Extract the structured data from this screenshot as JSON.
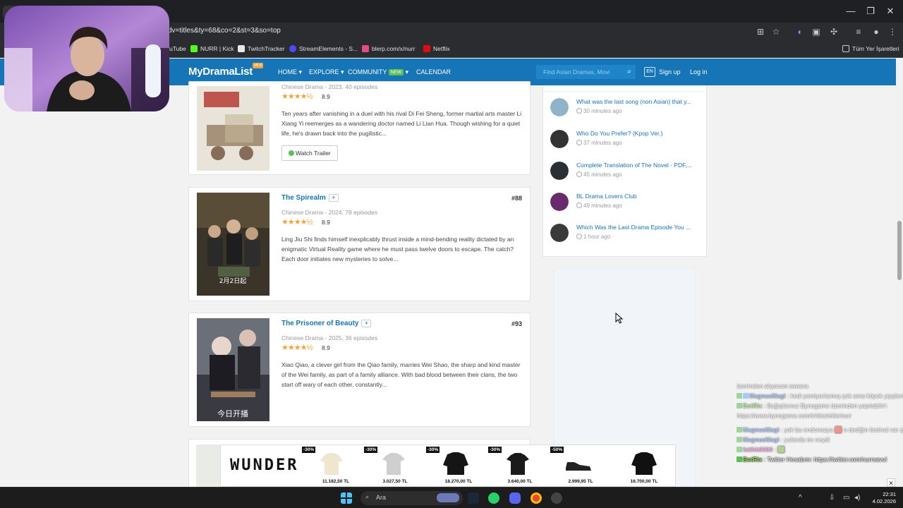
{
  "browser": {
    "url": "dv=titles&ty=68&co=2&st=3&so=top",
    "bookmarks": [
      "uTube",
      "NURR | Kick",
      "TwitchTracker",
      "StreamElements - S...",
      "blerp.com/x/nurr",
      "Netflix"
    ],
    "all_bookmarks": "Tüm Yer İşaretleri"
  },
  "site": {
    "logo": "MyDramaList",
    "logo_version": "v6.6",
    "nav": {
      "home": "HOME",
      "explore": "EXPLORE",
      "community": "COMMUNITY",
      "new_badge": "NEW",
      "calendar": "CALENDAR"
    },
    "search_placeholder": "Find Asian Dramas, Movi",
    "lang": "EN",
    "signup": "Sign up",
    "login": "Log in"
  },
  "dramas": [
    {
      "title": "",
      "meta": "Chinese Drama - 2023, 40 episodes",
      "stars": "★★★★½",
      "score": "8.9",
      "synopsis": "Ten years after vanishing in a duel with his rival Di Fei Sheng, former martial arts master Li Xiang Yi reemerges as a wandering doctor named Li Lian Hua. Though wishing for a quiet life, he's drawn back into the pugilistic...",
      "trailer_label": "Watch Trailer"
    },
    {
      "title": "The Spirealm",
      "rank": "#88",
      "meta": "Chinese Drama - 2024, 78 episodes",
      "stars": "★★★★½",
      "score": "8.9",
      "synopsis": "Ling Jiu Shi finds himself inexplicably thrust inside a mind-bending reality dictated by an enigmatic Virtual Reality game where he must pass twelve doors to escape. The catch? Each door initiates new mysteries to solve...",
      "poster_text": "2月2日起"
    },
    {
      "title": "The Prisoner of Beauty",
      "rank": "#93",
      "meta": "Chinese Drama - 2025, 36 episodes",
      "stars": "★★★★½",
      "score": "8.9",
      "synopsis": "Xiao Qiao, a clever girl from the Qiao family, marries Wei Shao, the sharp and kind master of the Wei family, as part of a family alliance. With bad blood between their clans, the two start off wary of each other, constantly...",
      "poster_text": "今日开播"
    }
  ],
  "plus_label": "+",
  "sidebar_threads": [
    {
      "title": "What was the last song (non Asian) that y...",
      "time": "30 minutes ago",
      "color": "#8fb3c9"
    },
    {
      "title": "Who Do You Prefer? (Kpop Ver.)",
      "time": "37 minutes ago",
      "color": "#333333"
    },
    {
      "title": "Complete Translation of The Novel - PDF,...",
      "time": "45 minutes ago",
      "color": "#2a2f36"
    },
    {
      "title": "BL Drama Lovers Club",
      "time": "49 minutes ago",
      "color": "#6a2a6e"
    },
    {
      "title": "Which Was the Last Drama Episode You ...",
      "time": "1 hour ago",
      "color": "#3a3a3a"
    }
  ],
  "chat": [
    {
      "user": "",
      "text": "üzerinden alıyorum sewsra",
      "color": "#ffffff",
      "faded": true
    },
    {
      "user": "MagnusMagi",
      "text": ": kedi yemiyorlarmış çok ama köpek yiyşlermiş",
      "color": "#7aa7ff",
      "faded": true
    },
    {
      "user": "BotRix",
      "text": ": Bağışlarınız Bynogame üzerinden yapılabilir!: https://www.bynogame.com/tr/destekle/nurr",
      "color": "#9be15d",
      "faded": true
    },
    {
      "user": "MagnusMagi",
      "text": ": yok bu endonezya 🟥 o dediğin festival var çinde",
      "color": "#7aa7ff",
      "faded": true
    },
    {
      "user": "MagnusMagi",
      "text": ": yulanda mı neydi",
      "color": "#7aa7ff",
      "faded": true
    },
    {
      "user": "fatihh0090",
      "text": ": 🟩",
      "color": "#ff7ad9",
      "faded": true
    },
    {
      "user": "BotRix",
      "text": ": Twitter Hesabım: https://twitter.com/nurrsavul",
      "color": "#9be15d",
      "faded": false
    }
  ],
  "ad": {
    "brand": "WUNDER",
    "products": [
      {
        "discount": "-30%",
        "price": "11.182,50 TL",
        "color": "#efe6cf"
      },
      {
        "discount": "-30%",
        "price": "3.027,50 TL",
        "color": "#cfcfcf"
      },
      {
        "discount": "-30%",
        "price": "18.270,00 TL",
        "color": "#151515"
      },
      {
        "discount": "-30%",
        "price": "3.640,00 TL",
        "color": "#1a1a1a"
      },
      {
        "discount": "-50%",
        "price": "2.999,95 TL",
        "color": "#222222"
      },
      {
        "discount": "",
        "price": "16.700,00 TL",
        "color": "#111111"
      }
    ]
  },
  "taskbar": {
    "search": "Ara",
    "time": "22:31",
    "date": "4.02.2026"
  }
}
